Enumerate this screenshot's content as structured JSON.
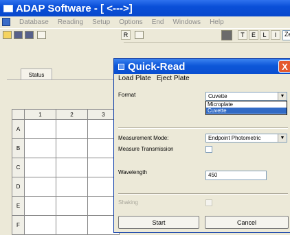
{
  "window": {
    "title": "ADAP Software - [ <--->]"
  },
  "menubar": {
    "items": [
      "Database",
      "Reading",
      "Setup",
      "Options",
      "End",
      "Windows",
      "Help"
    ]
  },
  "toolbar": {
    "r_label": "R",
    "letter_buttons": [
      "T",
      "E",
      "L",
      "I"
    ],
    "field_value": "Ze"
  },
  "left_pane": {
    "tab_label": "Status",
    "columns": [
      "1",
      "2",
      "3"
    ],
    "rows": [
      "A",
      "B",
      "C",
      "D",
      "E",
      "F"
    ]
  },
  "dialog": {
    "title": "Quick-Read",
    "close_label": "X",
    "menu": [
      "Load Plate",
      "Eject Plate"
    ],
    "format_label": "Format",
    "format_value": "Cuvette",
    "format_options": [
      "Microplate",
      "Cuvette"
    ],
    "format_selected_option": "Cuvette",
    "mode_label": "Measurement Mode:",
    "mode_value": "Endpoint Photometric",
    "transmission_label": "Measure Transmission",
    "wavelength_label": "Wavelength",
    "wavelength_value": "450",
    "shaking_label": "Shaking",
    "start_label": "Start",
    "cancel_label": "Cancel"
  }
}
